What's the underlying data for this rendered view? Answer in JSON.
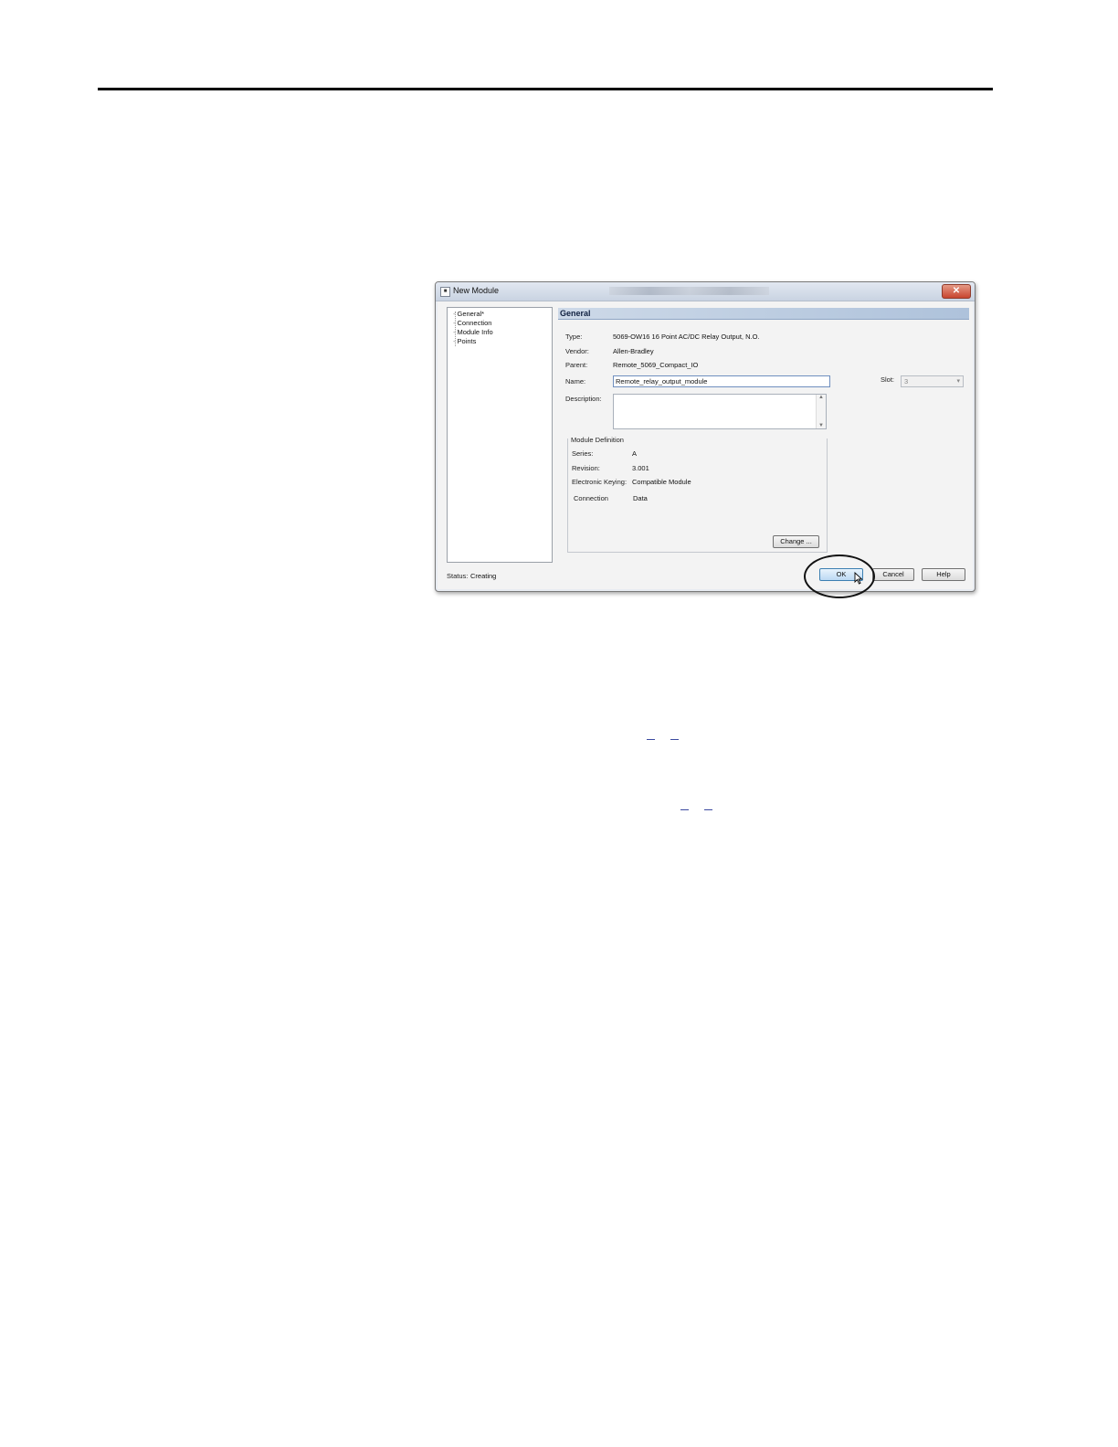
{
  "dialog": {
    "title": "New Module",
    "close_glyph": "✕",
    "tree": {
      "items": [
        {
          "label": "General*"
        },
        {
          "label": "Connection"
        },
        {
          "label": "Module Info"
        },
        {
          "label": "Points"
        }
      ]
    },
    "section_header": "General",
    "fields": {
      "type_label": "Type:",
      "type_value": "5069-OW16 16 Point AC/DC Relay Output, N.O.",
      "vendor_label": "Vendor:",
      "vendor_value": "Allen-Bradley",
      "parent_label": "Parent:",
      "parent_value": "Remote_5069_Compact_IO",
      "name_label": "Name:",
      "name_value": "Remote_relay_output_module",
      "description_label": "Description:",
      "slot_label": "Slot:",
      "slot_value": "3"
    },
    "module_definition": {
      "title": "Module Definition",
      "series_label": "Series:",
      "series_value": "A",
      "revision_label": "Revision:",
      "revision_value": "3.001",
      "keying_label": "Electronic Keying:",
      "keying_value": "Compatible Module",
      "connection_label": "Connection",
      "connection_value": "Data",
      "change_button": "Change ..."
    },
    "status_label": "Status:",
    "status_value": "Creating",
    "buttons": {
      "ok": "OK",
      "cancel": "Cancel",
      "help": "Help"
    }
  }
}
